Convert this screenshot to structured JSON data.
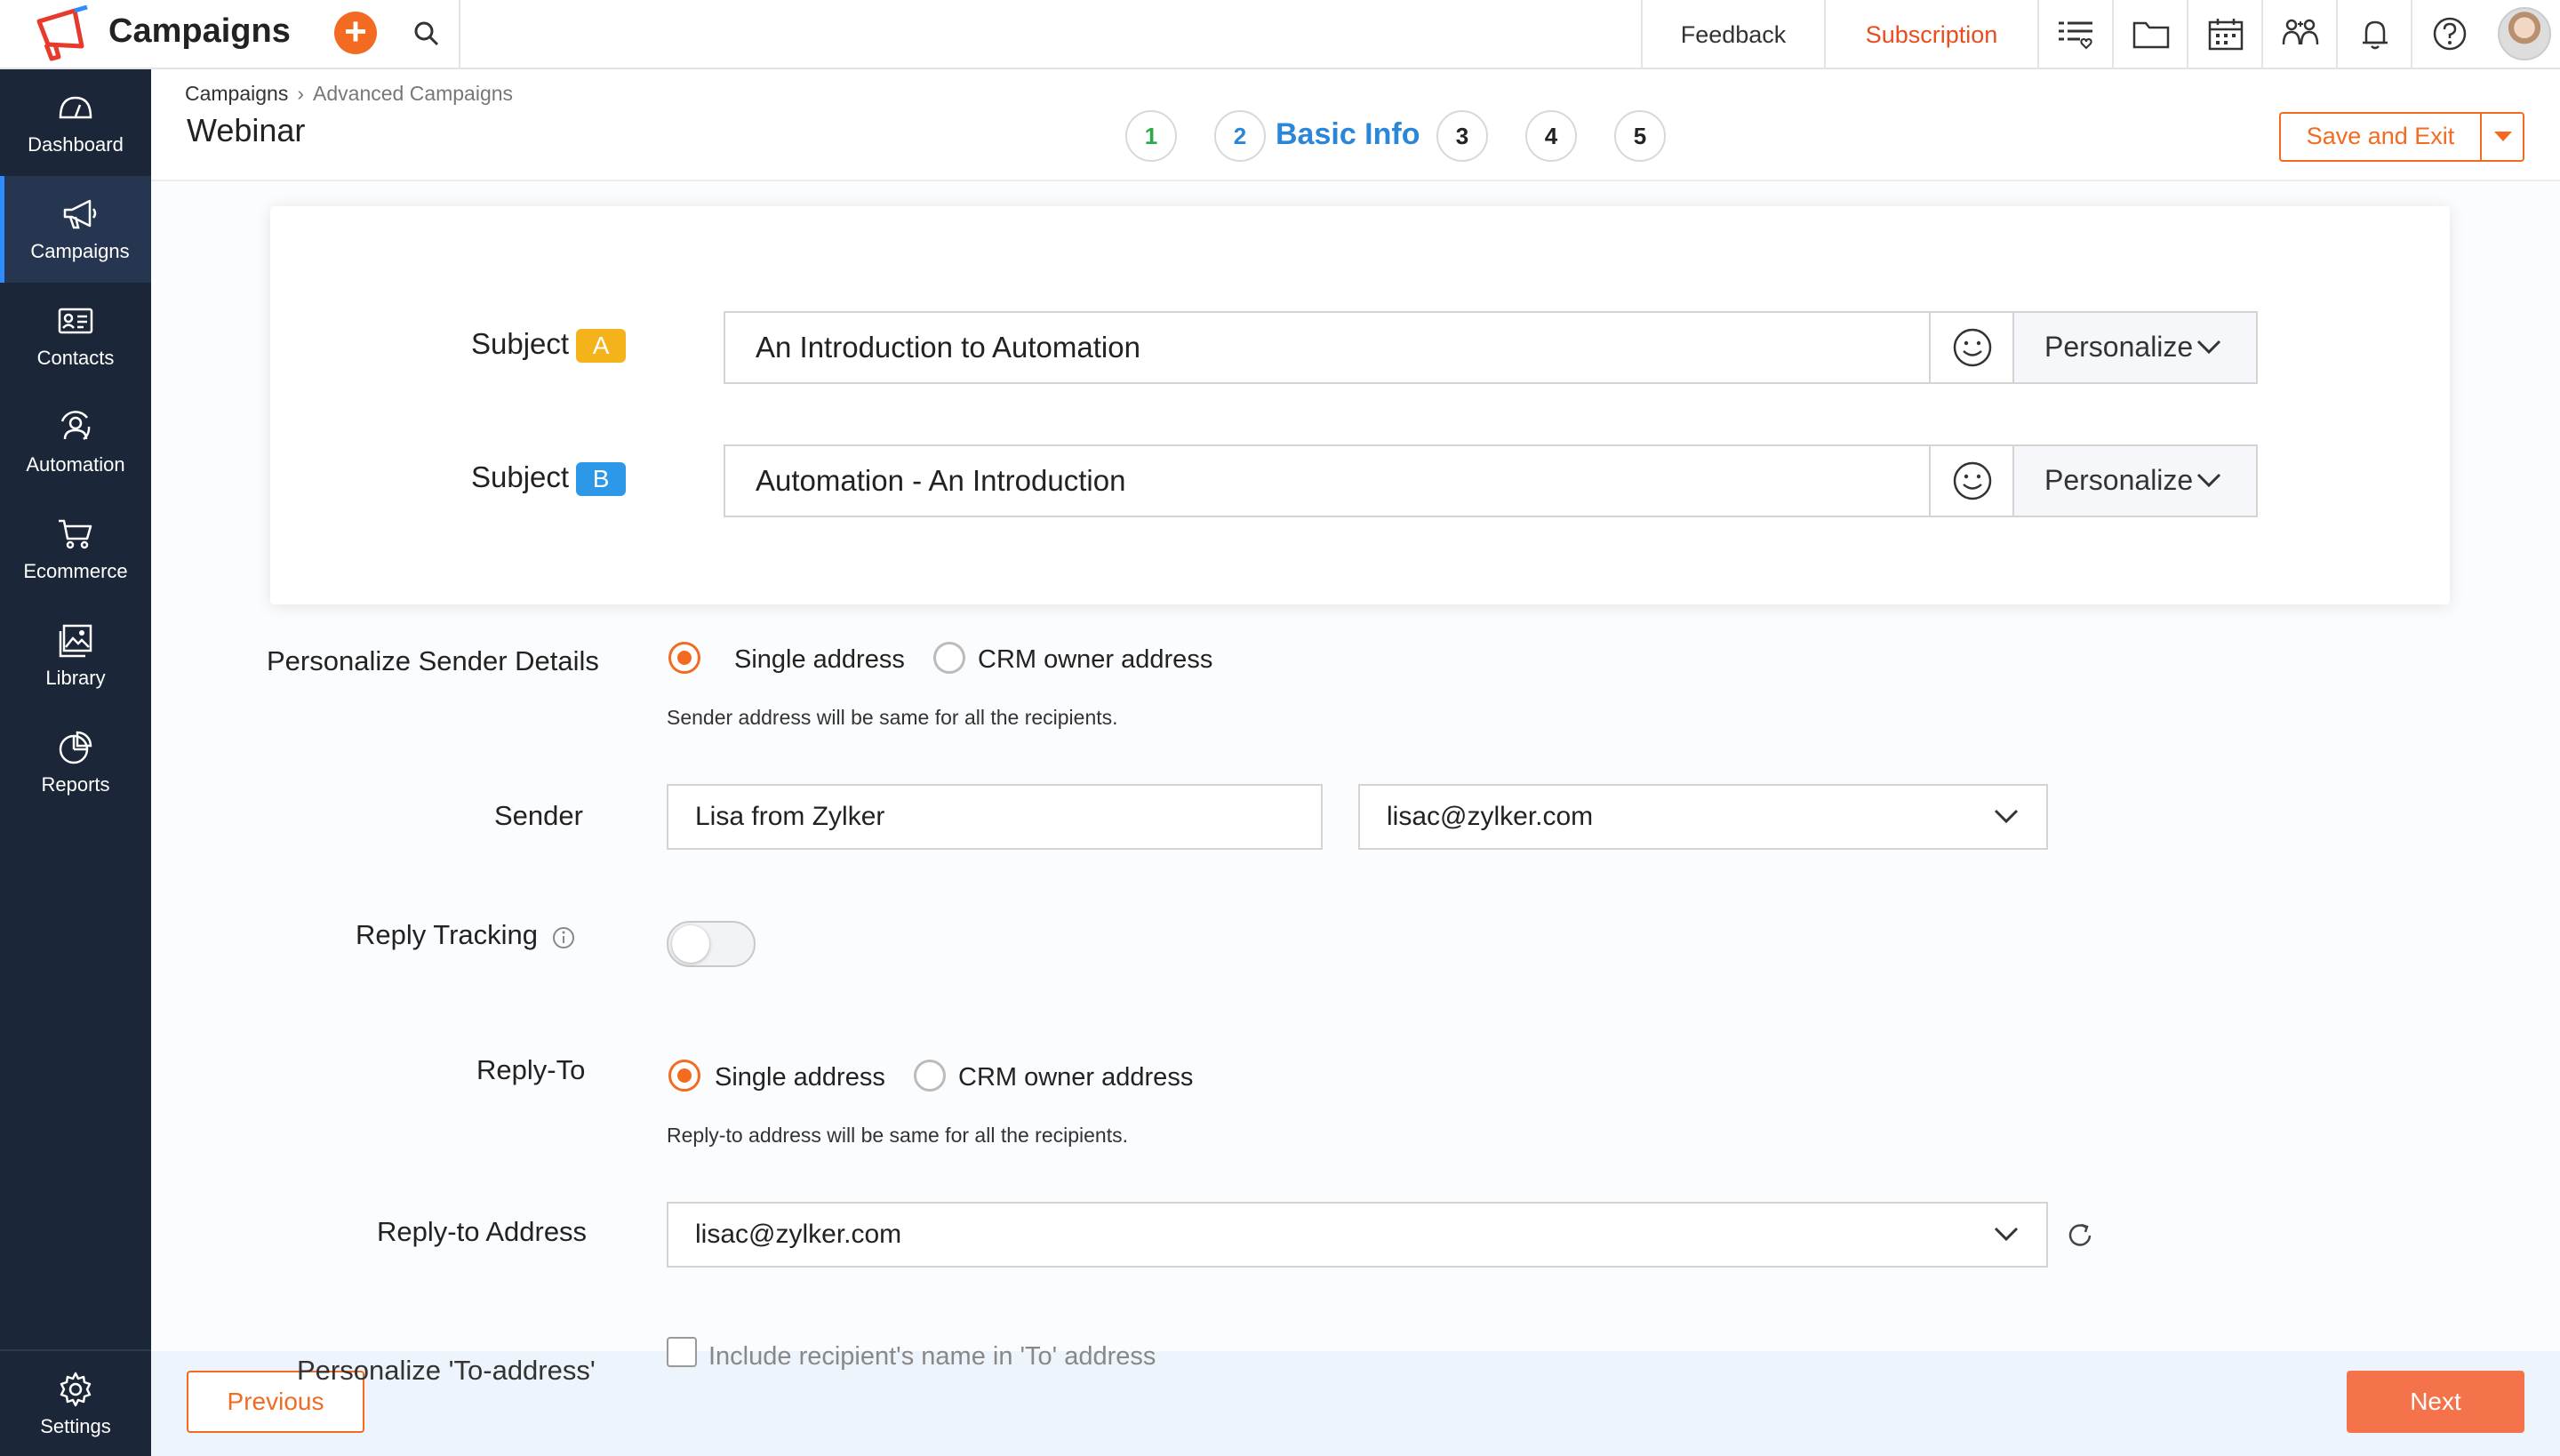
{
  "app": {
    "title": "Campaigns"
  },
  "topbar": {
    "feedback": "Feedback",
    "subscription": "Subscription"
  },
  "sidebar": {
    "items": [
      {
        "label": "Dashboard",
        "icon": "gauge-icon"
      },
      {
        "label": "Campaigns",
        "icon": "megaphone-icon",
        "active": true
      },
      {
        "label": "Contacts",
        "icon": "contact-card-icon"
      },
      {
        "label": "Automation",
        "icon": "automation-icon"
      },
      {
        "label": "Ecommerce",
        "icon": "cart-icon"
      },
      {
        "label": "Library",
        "icon": "image-library-icon"
      },
      {
        "label": "Reports",
        "icon": "pie-chart-icon"
      }
    ],
    "settings": "Settings"
  },
  "breadcrumb": {
    "parent": "Campaigns",
    "current": "Advanced Campaigns"
  },
  "page": {
    "title": "Webinar"
  },
  "steps": {
    "items": [
      "1",
      "2",
      "3",
      "4",
      "5"
    ],
    "current_index": 2,
    "current_label": "Basic Info"
  },
  "actions": {
    "save_exit": "Save and Exit"
  },
  "subjects": {
    "label": "Subject",
    "a": {
      "badge": "A",
      "value": "An Introduction to Automation"
    },
    "b": {
      "badge": "B",
      "value": "Automation - An Introduction"
    },
    "personalize": "Personalize"
  },
  "sender_details": {
    "label": "Personalize Sender Details",
    "options": [
      "Single address",
      "CRM owner address"
    ],
    "selected": "Single address",
    "hint": "Sender address will be same for all the recipients."
  },
  "sender": {
    "label": "Sender",
    "name": "Lisa from Zylker",
    "email": "lisac@zylker.com"
  },
  "reply_tracking": {
    "label": "Reply Tracking",
    "enabled": false
  },
  "reply_to": {
    "label": "Reply-To",
    "options": [
      "Single address",
      "CRM owner address"
    ],
    "selected": "Single address",
    "hint": "Reply-to address will be same for all the recipients."
  },
  "reply_to_address": {
    "label": "Reply-to Address",
    "value": "lisac@zylker.com"
  },
  "to_address": {
    "label": "Personalize 'To-address'",
    "checkbox": "Include recipient's name in 'To' address",
    "checked": false
  },
  "footer": {
    "previous": "Previous",
    "next": "Next"
  },
  "colors": {
    "accent": "#f26b21",
    "sidebar": "#1b2638",
    "step_active": "#2a86d8",
    "badge_a": "#f5b31b",
    "badge_b": "#2d98e8"
  }
}
